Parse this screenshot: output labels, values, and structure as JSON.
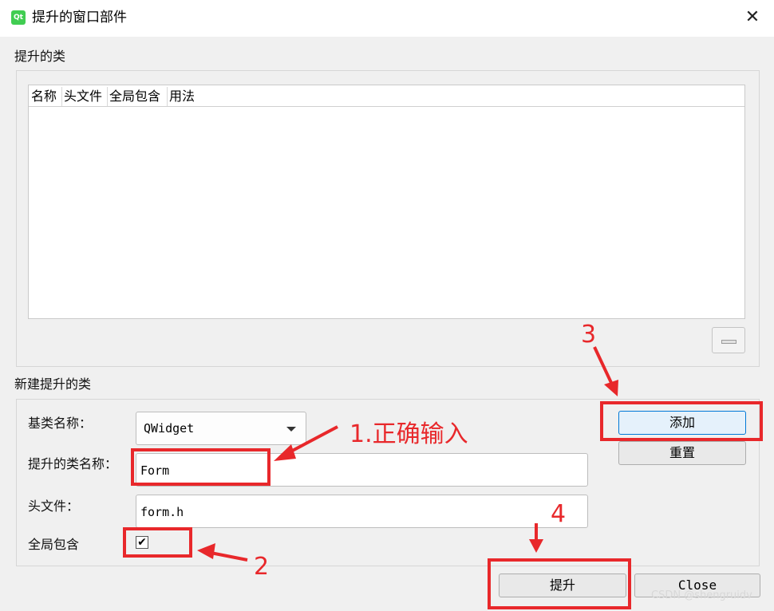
{
  "window": {
    "title": "提升的窗口部件",
    "app_icon": "qt-icon"
  },
  "promoted_section": {
    "title": "提升的类",
    "columns": [
      "名称",
      "头文件",
      "全局包含",
      "用法"
    ],
    "remove_button_icon": "minus-icon"
  },
  "new_section": {
    "title": "新建提升的类",
    "base_class_label": "基类名称：",
    "base_class_value": "QWidget",
    "class_name_label": "提升的类名称：",
    "class_name_value": "Form",
    "header_label": "头文件：",
    "header_value": "form.h",
    "global_include_label": "全局包含",
    "global_include_checked": true
  },
  "buttons": {
    "add": "添加",
    "reset": "重置",
    "promote": "提升",
    "close": "Close"
  },
  "annotations": {
    "step1": "1.正确输入",
    "step2": "2",
    "step3": "3",
    "step4": "4",
    "color": "#e8282b"
  },
  "watermark": "CSDN @shengruidv"
}
